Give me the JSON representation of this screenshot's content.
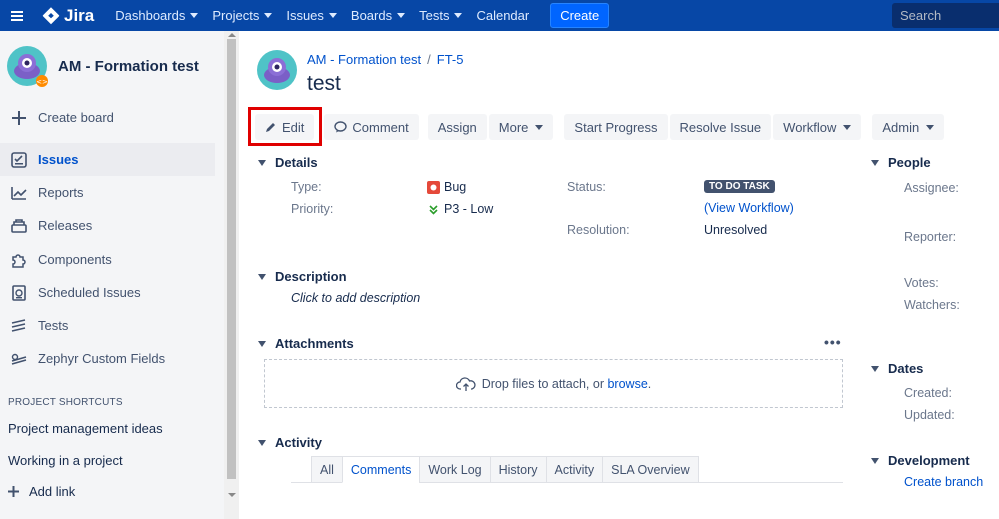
{
  "topnav": {
    "app_name": "Jira",
    "items": [
      {
        "label": "Dashboards",
        "dropdown": true
      },
      {
        "label": "Projects",
        "dropdown": true
      },
      {
        "label": "Issues",
        "dropdown": true
      },
      {
        "label": "Boards",
        "dropdown": true
      },
      {
        "label": "Tests",
        "dropdown": true
      },
      {
        "label": "Calendar",
        "dropdown": false
      }
    ],
    "create_label": "Create",
    "search_placeholder": "Search",
    "colors": {
      "bar": "#0747a6",
      "create": "#0065ff"
    }
  },
  "sidebar": {
    "project_name": "AM - Formation test",
    "create_board": "Create board",
    "items": [
      {
        "label": "Issues",
        "icon": "issues-icon",
        "active": true
      },
      {
        "label": "Reports",
        "icon": "reports-icon",
        "active": false
      },
      {
        "label": "Releases",
        "icon": "releases-icon",
        "active": false
      },
      {
        "label": "Components",
        "icon": "components-icon",
        "active": false
      },
      {
        "label": "Scheduled Issues",
        "icon": "scheduled-issues-icon",
        "active": false
      },
      {
        "label": "Tests",
        "icon": "tests-icon",
        "active": false
      },
      {
        "label": "Zephyr Custom Fields",
        "icon": "zephyr-icon",
        "active": false
      }
    ],
    "shortcuts_heading": "PROJECT SHORTCUTS",
    "shortcuts": [
      "Project management ideas",
      "Working in a project"
    ],
    "add_link": "Add link"
  },
  "issue": {
    "breadcrumb": {
      "project": "AM - Formation test",
      "key": "FT-5"
    },
    "title": "test",
    "toolbar": {
      "edit": "Edit",
      "comment": "Comment",
      "assign": "Assign",
      "more": "More",
      "start_progress": "Start Progress",
      "resolve_issue": "Resolve Issue",
      "workflow": "Workflow",
      "admin": "Admin"
    },
    "details": {
      "heading": "Details",
      "type_label": "Type:",
      "type_value": "Bug",
      "priority_label": "Priority:",
      "priority_value": "P3 - Low",
      "status_label": "Status:",
      "status_value": "TO DO TASK",
      "view_workflow": "(View Workflow)",
      "resolution_label": "Resolution:",
      "resolution_value": "Unresolved"
    },
    "description": {
      "heading": "Description",
      "placeholder": "Click to add description"
    },
    "attachments": {
      "heading": "Attachments",
      "drop_text": "Drop files to attach, or ",
      "browse": "browse",
      "after": "."
    },
    "activity": {
      "heading": "Activity",
      "tabs": [
        {
          "label": "All",
          "active": false
        },
        {
          "label": "Comments",
          "active": true
        },
        {
          "label": "Work Log",
          "active": false
        },
        {
          "label": "History",
          "active": false
        },
        {
          "label": "Activity",
          "active": false
        },
        {
          "label": "SLA Overview",
          "active": false
        }
      ]
    },
    "people": {
      "heading": "People",
      "assignee": "Assignee:",
      "reporter": "Reporter:",
      "votes": "Votes:",
      "watchers": "Watchers:"
    },
    "dates": {
      "heading": "Dates",
      "created": "Created:",
      "updated": "Updated:"
    },
    "development": {
      "heading": "Development",
      "create_branch": "Create branch"
    }
  }
}
